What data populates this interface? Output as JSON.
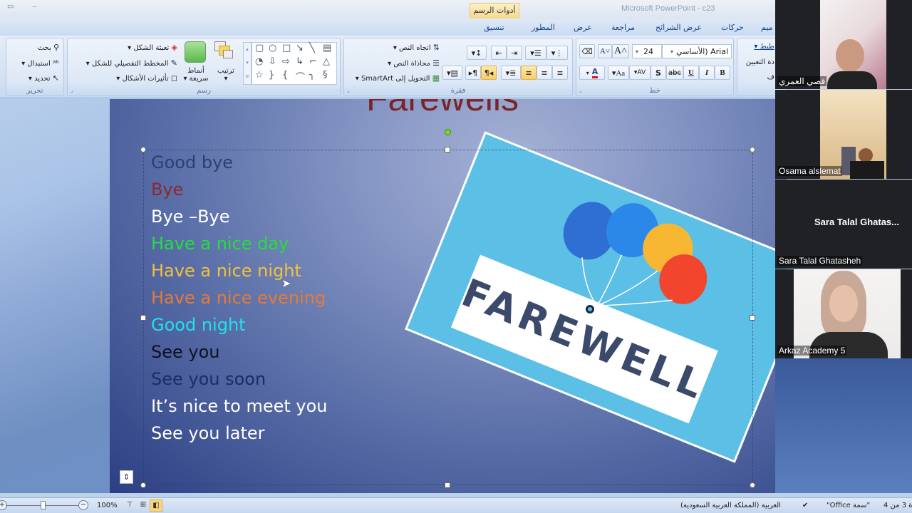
{
  "window": {
    "title": "Microsoft PowerPoint - c23",
    "contextual_tab_group": "أدوات الرسم"
  },
  "tabs": [
    {
      "label": "تنسيق",
      "active": false,
      "contextual": true
    },
    {
      "label": "المطور"
    },
    {
      "label": "عرض"
    },
    {
      "label": "مراجعة"
    },
    {
      "label": "عرض الشرائح"
    },
    {
      "label": "حركات"
    },
    {
      "label": "ميم"
    }
  ],
  "ribbon": {
    "editing": {
      "label": "تحرير",
      "find": "بحث",
      "replace": "استبدال",
      "select": "تحديد"
    },
    "drawing": {
      "label": "رسم",
      "shape_fill": "تعبئة الشكل",
      "shape_outline": "المخطط التفصيلي للشكل",
      "shape_effects": "تأثيرات الأشكال",
      "quick_styles_line1": "أنماط",
      "quick_styles_line2": "سريعة",
      "arrange": "ترتيب"
    },
    "paragraph": {
      "label": "فقرة",
      "text_direction": "اتجاه النص",
      "align_text": "محاذاة النص",
      "convert_smartart": "التحويل إلى SmartArt"
    },
    "font": {
      "label": "خط",
      "font_name": "Arial (الأساسي",
      "font_size": "24",
      "bold": "B",
      "italic": "I",
      "underline": "U",
      "strike": "abc",
      "shadow": "S",
      "spacing": "AV",
      "change_case": "Aa",
      "font_color": "#d11a1a"
    },
    "partial_group": {
      "item1": "طيط",
      "item2": "دة التعيين",
      "item3": "ف"
    }
  },
  "slide": {
    "title": "Farewells",
    "bullets": [
      {
        "text": "Good bye",
        "color": "#2a3f73"
      },
      {
        "text": "Bye",
        "color": "#8a2a2a"
      },
      {
        "text": "Bye –Bye",
        "color": "#ffffff"
      },
      {
        "text": "Have a nice day",
        "color": "#22e03a"
      },
      {
        "text": "Have a nice night",
        "color": "#f2c23a"
      },
      {
        "text": "Have a nice evening",
        "color": "#e87a35"
      },
      {
        "text": "Good night",
        "color": "#22e0ee"
      },
      {
        "text": "See you",
        "color": "#0d1020"
      },
      {
        "text": "See you soon",
        "color": "#1c2c66"
      },
      {
        "text": "It’s nice to meet you",
        "color": "#ffffff"
      },
      {
        "text": "See you later",
        "color": "#ffffff"
      }
    ],
    "picture_text": "FAREWELL"
  },
  "participants": [
    {
      "name": "قصي العمري",
      "video": true
    },
    {
      "name": "Osama alslemat",
      "video": true
    },
    {
      "name": "Sara Talal Ghatasheh",
      "display_center": "Sara Talal Ghatas...",
      "video": false
    },
    {
      "name": "Arkaz Academy 5",
      "video": true
    }
  ],
  "statusbar": {
    "slide_info": "ة 3 من 4",
    "theme": "\"سمة Office\"",
    "language": "العربية (المملكة العربية السعودية)",
    "zoom": "100%",
    "zoom_level_percent": 100
  }
}
